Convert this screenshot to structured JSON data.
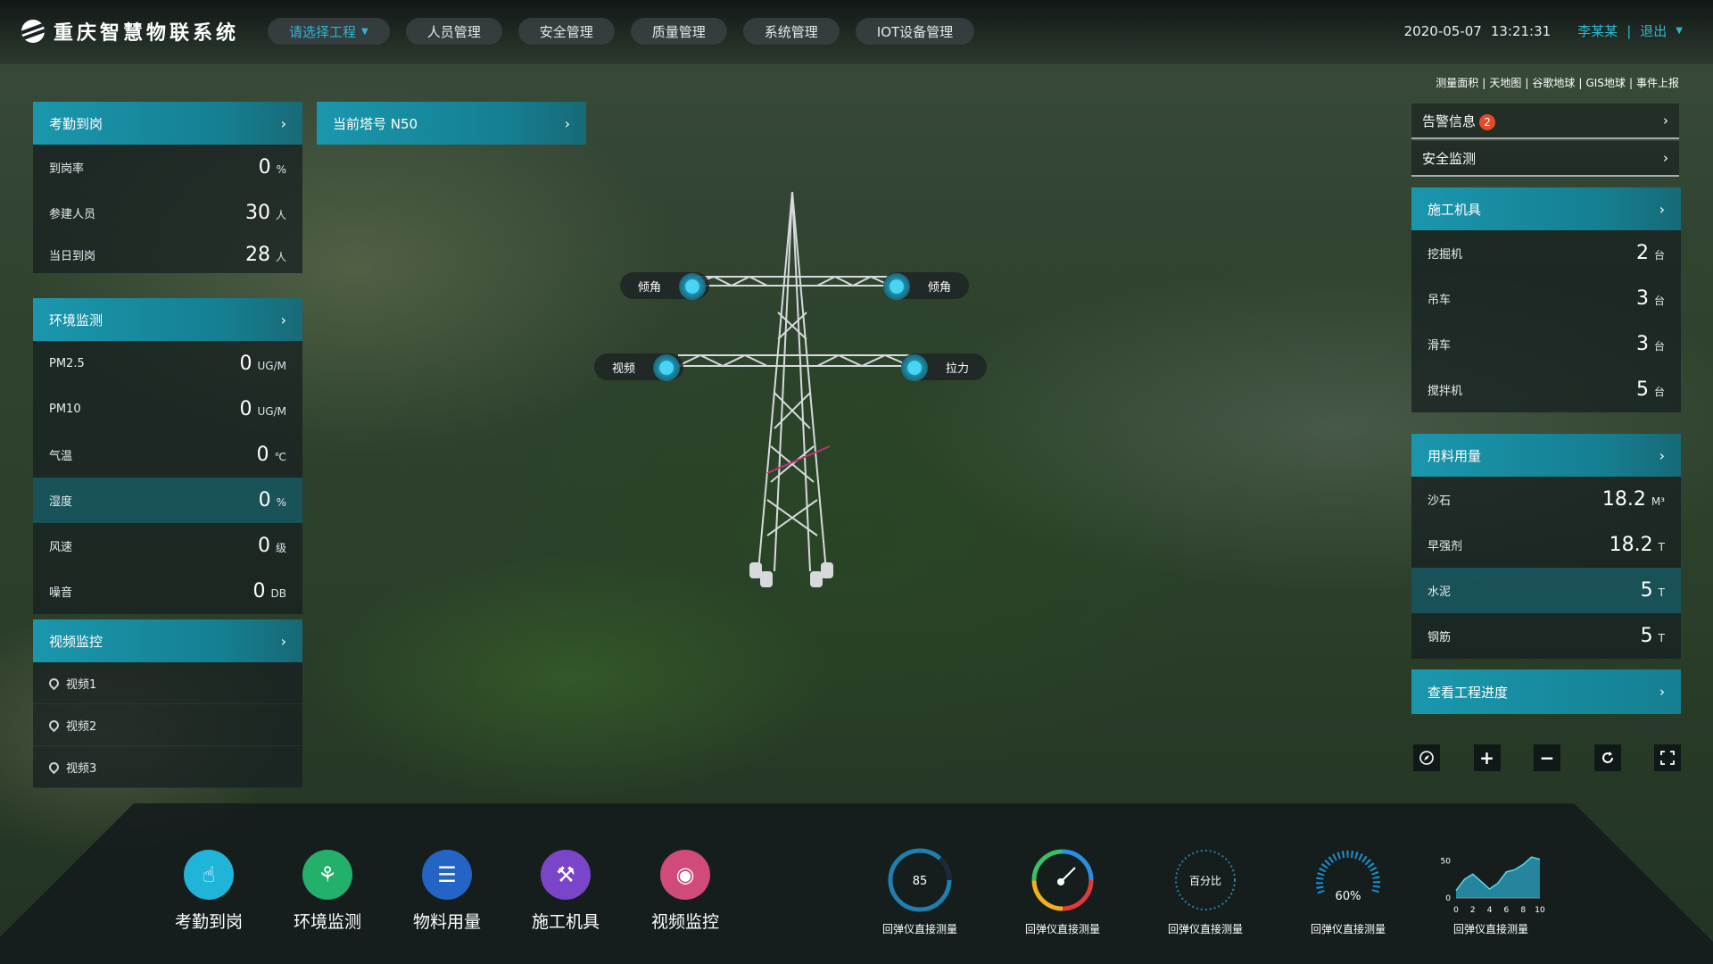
{
  "header": {
    "app_title": "重庆智慧物联系统",
    "nav": [
      "请选择工程",
      "人员管理",
      "安全管理",
      "质量管理",
      "系统管理",
      "IOT设备管理"
    ],
    "date": "2020-05-07",
    "time": "13:21:31",
    "user": "李某某",
    "separator": "|",
    "logout": "退出"
  },
  "map_links": [
    "测量面积",
    "天地图",
    "谷歌地球",
    "GIS地球",
    "事件上报"
  ],
  "map_links_sep": "|",
  "attendance": {
    "title": "考勤到岗",
    "rows": [
      {
        "label": "到岗率",
        "value": "0",
        "unit": "%"
      },
      {
        "label": "参建人员",
        "value": "30",
        "unit": "人"
      },
      {
        "label": "当日到岗",
        "value": "28",
        "unit": "人"
      }
    ]
  },
  "environment": {
    "title": "环境监测",
    "rows": [
      {
        "label": "PM2.5",
        "value": "0",
        "unit": "UG/M"
      },
      {
        "label": "PM10",
        "value": "0",
        "unit": "UG/M"
      },
      {
        "label": "气温",
        "value": "0",
        "unit": "℃"
      },
      {
        "label": "湿度",
        "value": "0",
        "unit": "%"
      },
      {
        "label": "风速",
        "value": "0",
        "unit": "级"
      },
      {
        "label": "噪音",
        "value": "0",
        "unit": "DB"
      }
    ]
  },
  "video": {
    "title": "视频监控",
    "items": [
      "视频1",
      "视频2",
      "视频3"
    ]
  },
  "tower": {
    "title": "当前塔号 N50",
    "tags": {
      "tilt_left": "倾角",
      "tilt_right": "倾角",
      "video": "视频",
      "tension": "拉力"
    }
  },
  "alerts": {
    "title": "告警信息",
    "count": "2",
    "safety": "安全监测"
  },
  "machines": {
    "title": "施工机具",
    "rows": [
      {
        "label": "挖掘机",
        "value": "2",
        "unit": "台"
      },
      {
        "label": "吊车",
        "value": "3",
        "unit": "台"
      },
      {
        "label": "滑车",
        "value": "3",
        "unit": "台"
      },
      {
        "label": "搅拌机",
        "value": "5",
        "unit": "台"
      }
    ]
  },
  "materials": {
    "title": "用料用量",
    "rows": [
      {
        "label": "沙石",
        "value": "18.2",
        "unit": "M³"
      },
      {
        "label": "早强剂",
        "value": "18.2",
        "unit": "T"
      },
      {
        "label": "水泥",
        "value": "5",
        "unit": "T"
      },
      {
        "label": "钢筋",
        "value": "5",
        "unit": "T"
      }
    ]
  },
  "progress_button": "查看工程进度",
  "dock": {
    "items": [
      {
        "label": "考勤到岗",
        "icon": "hand-touch-icon",
        "color": "#1fb4d8"
      },
      {
        "label": "环境监测",
        "icon": "tree-icon",
        "color": "#22b06a"
      },
      {
        "label": "物料用量",
        "icon": "database-icon",
        "color": "#2364c4"
      },
      {
        "label": "施工机具",
        "icon": "excavator-icon",
        "color": "#7a45c8"
      },
      {
        "label": "视频监控",
        "icon": "camera-icon",
        "color": "#d04a7a"
      }
    ],
    "gauges": [
      {
        "label": "回弹仪直接测量",
        "value": "85"
      },
      {
        "label": "回弹仪直接测量"
      },
      {
        "label": "回弹仪直接测量",
        "value": "百分比"
      },
      {
        "label": "回弹仪直接测量",
        "value": "60%",
        "fraction": 0.6
      },
      {
        "label": "回弹仪直接测量"
      }
    ],
    "mini_chart": {
      "type": "area",
      "x_ticks": [
        "0",
        "2",
        "4",
        "6",
        "8",
        "10"
      ],
      "y_ticks": [
        "50",
        "0"
      ],
      "x": [
        0,
        1,
        2,
        3,
        4,
        5,
        6,
        7,
        8,
        9,
        10
      ],
      "values": [
        10,
        25,
        32,
        22,
        12,
        20,
        35,
        38,
        45,
        55,
        52
      ],
      "ylim": [
        0,
        60
      ]
    }
  }
}
